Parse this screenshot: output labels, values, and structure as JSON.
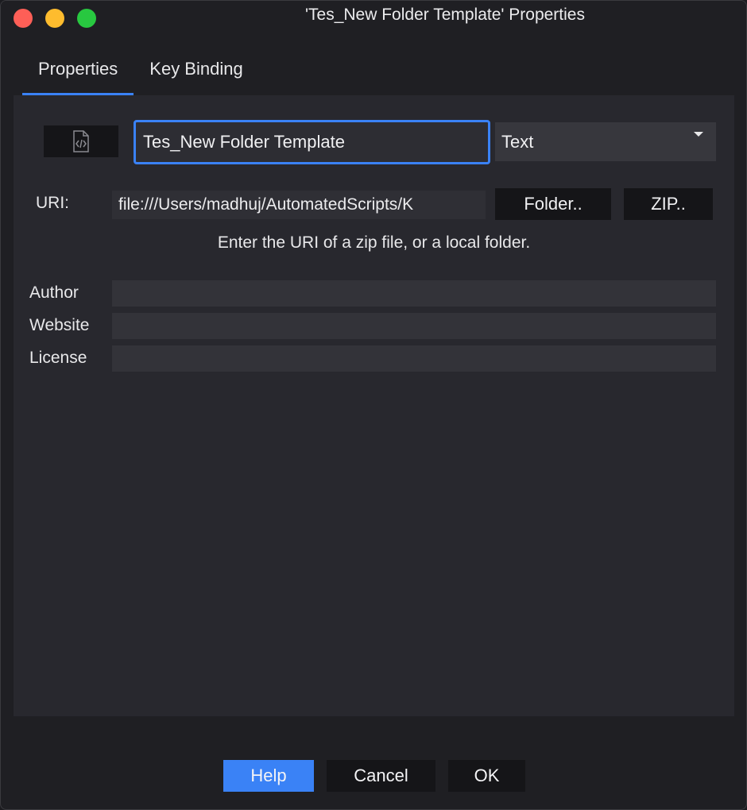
{
  "window": {
    "title": "'Tes_New Folder Template' Properties"
  },
  "tabs": [
    {
      "label": "Properties",
      "active": true
    },
    {
      "label": "Key Binding",
      "active": false
    }
  ],
  "properties": {
    "icon": "code-file-icon",
    "name_value": "Tes_New Folder Template",
    "type_selected": "Text",
    "uri_label": "URI:",
    "uri_value": "file:///Users/madhuj/AutomatedScripts/K",
    "folder_button": "Folder..",
    "zip_button": "ZIP..",
    "hint": "Enter the URI of a zip file, or a local folder.",
    "fields": [
      {
        "label": "Author",
        "value": ""
      },
      {
        "label": "Website",
        "value": ""
      },
      {
        "label": "License",
        "value": ""
      }
    ]
  },
  "footer": {
    "help": "Help",
    "cancel": "Cancel",
    "ok": "OK"
  },
  "colors": {
    "accent": "#3a82f6",
    "close": "#fe5f57",
    "minimize": "#febc2e",
    "maximize": "#28c840"
  }
}
